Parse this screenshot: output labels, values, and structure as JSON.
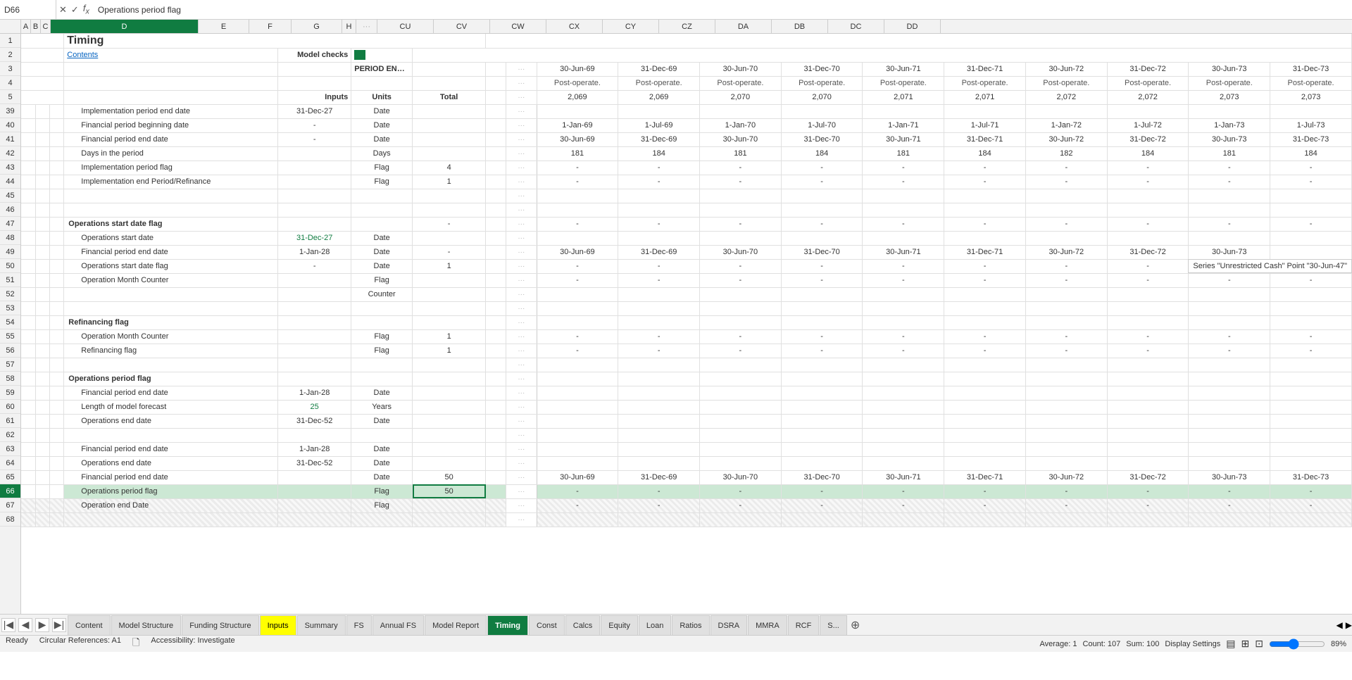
{
  "formulaBar": {
    "cellRef": "D66",
    "formula": "Operations period flag"
  },
  "title": "Timing",
  "contentsLink": "Contents",
  "modelChecks": "Model checks",
  "periodEndDate": "PERIOD END DATE",
  "columnHeaders": [
    "A",
    "B",
    "C",
    "D",
    "E",
    "F",
    "G",
    "H",
    "",
    "CU",
    "CV",
    "CW",
    "CX",
    "CY",
    "CZ",
    "DA",
    "DB",
    "DC",
    "DD"
  ],
  "subHeaders": {
    "inputs": "Inputs",
    "units": "Units",
    "total": "Total"
  },
  "periods": [
    "30-Jun-69",
    "31-Dec-69",
    "30-Jun-70",
    "31-Dec-70",
    "30-Jun-71",
    "31-Dec-71",
    "30-Jun-72",
    "31-Dec-72",
    "30-Jun-73",
    "31-Dec-73"
  ],
  "periodType": "Post-operate.",
  "periodNumbers": [
    "2,069",
    "2,069",
    "2,070",
    "2,070",
    "2,071",
    "2,071",
    "2,072",
    "2,072",
    "2,073",
    "2,073"
  ],
  "rows": [
    {
      "num": 39,
      "label": "Implementation period end date",
      "input": "31-Dec-27",
      "unit": "Date",
      "total": "",
      "values": []
    },
    {
      "num": 40,
      "label": "Financial period beginning date",
      "input": "-",
      "unit": "Date",
      "total": "",
      "values": [
        "1-Jan-69",
        "1-Jul-69",
        "1-Jan-70",
        "1-Jul-70",
        "1-Jan-71",
        "1-Jul-71",
        "1-Jan-72",
        "1-Jul-72",
        "1-Jan-73",
        "1-Jul-73"
      ]
    },
    {
      "num": 41,
      "label": "Financial period end date",
      "input": "-",
      "unit": "Date",
      "total": "",
      "values": [
        "30-Jun-69",
        "31-Dec-69",
        "30-Jun-70",
        "31-Dec-70",
        "30-Jun-71",
        "31-Dec-71",
        "30-Jun-72",
        "31-Dec-72",
        "30-Jun-73",
        "31-Dec-73"
      ]
    },
    {
      "num": 42,
      "label": "Days in the period",
      "input": "",
      "unit": "Days",
      "total": "",
      "values": [
        "181",
        "184",
        "181",
        "184",
        "181",
        "184",
        "182",
        "184",
        "181",
        "184"
      ]
    },
    {
      "num": 43,
      "label": "Implementation period flag",
      "input": "",
      "unit": "Flag",
      "total": "4",
      "values": [
        "-",
        "-",
        "-",
        "-",
        "-",
        "-",
        "-",
        "-",
        "-",
        "-"
      ]
    },
    {
      "num": 44,
      "label": "Implementation end Period/Refinance",
      "input": "",
      "unit": "Flag",
      "total": "1",
      "values": [
        "-",
        "-",
        "-",
        "-",
        "-",
        "-",
        "-",
        "-",
        "-",
        "-"
      ]
    },
    {
      "num": 45,
      "label": "",
      "input": "",
      "unit": "",
      "total": "",
      "values": []
    },
    {
      "num": 46,
      "label": "",
      "input": "",
      "unit": "",
      "total": "",
      "values": []
    },
    {
      "num": 47,
      "label": "Operations start date flag",
      "input": "",
      "unit": "",
      "total": "-",
      "values": [
        "-",
        "-",
        "-",
        "-",
        "-",
        "-",
        "-",
        "-",
        "-",
        "-"
      ],
      "bold": true
    },
    {
      "num": 48,
      "label": "Operations start date",
      "input": "31-Dec-27",
      "unit": "Date",
      "total": "",
      "values": [],
      "inputGreen": true
    },
    {
      "num": 49,
      "label": "Financial period end date",
      "input": "1-Jan-28",
      "unit": "Date",
      "total": "-",
      "values": [
        "30-Jun-69",
        "31-Dec-69",
        "30-Jun-70",
        "31-Dec-70",
        "30-Jun-71",
        "31-Dec-71",
        "30-Jun-72",
        "31-Dec-72",
        "30-Jun-73",
        ""
      ],
      "hasTooltip": true
    },
    {
      "num": 50,
      "label": "Operations start date flag",
      "input": "-",
      "unit": "Date",
      "total": "1",
      "values": [
        "-",
        "-",
        "-",
        "-",
        "-",
        "-",
        "-",
        "-",
        "-",
        "-"
      ]
    },
    {
      "num": 51,
      "label": "Operation Month Counter",
      "input": "",
      "unit": "Flag",
      "total": "",
      "values": [
        "-",
        "-",
        "-",
        "-",
        "-",
        "-",
        "-",
        "-",
        "-",
        "-"
      ]
    },
    {
      "num": 52,
      "label": "",
      "input": "",
      "unit": "Counter",
      "total": "",
      "values": []
    },
    {
      "num": 53,
      "label": "",
      "input": "",
      "unit": "",
      "total": "",
      "values": []
    },
    {
      "num": 54,
      "label": "Refinancing flag",
      "input": "",
      "unit": "",
      "total": "",
      "values": [],
      "bold": true
    },
    {
      "num": 55,
      "label": "Operation Month Counter",
      "input": "",
      "unit": "Flag",
      "total": "1",
      "values": [
        "-",
        "-",
        "-",
        "-",
        "-",
        "-",
        "-",
        "-",
        "-",
        "-"
      ]
    },
    {
      "num": 56,
      "label": "Refinancing flag",
      "input": "",
      "unit": "Flag",
      "total": "1",
      "values": [
        "-",
        "-",
        "-",
        "-",
        "-",
        "-",
        "-",
        "-",
        "-",
        "-"
      ]
    },
    {
      "num": 57,
      "label": "",
      "input": "",
      "unit": "",
      "total": "",
      "values": []
    },
    {
      "num": 58,
      "label": "Operations period flag",
      "input": "",
      "unit": "",
      "total": "",
      "values": [],
      "bold": true
    },
    {
      "num": 59,
      "label": "Financial period end date",
      "input": "1-Jan-28",
      "unit": "Date",
      "total": "",
      "values": []
    },
    {
      "num": 60,
      "label": "Length of model forecast",
      "input": "25",
      "unit": "Years",
      "total": "",
      "values": [],
      "inputGreen": true
    },
    {
      "num": 61,
      "label": "Operations end date",
      "input": "31-Dec-52",
      "unit": "Date",
      "total": "",
      "values": []
    },
    {
      "num": 62,
      "label": "",
      "input": "",
      "unit": "",
      "total": "",
      "values": []
    },
    {
      "num": 63,
      "label": "Financial period end date",
      "input": "1-Jan-28",
      "unit": "Date",
      "total": "",
      "values": []
    },
    {
      "num": 64,
      "label": "Operations end date",
      "input": "31-Dec-52",
      "unit": "Date",
      "total": "",
      "values": []
    },
    {
      "num": 65,
      "label": "Financial period end date",
      "input": "",
      "unit": "Date",
      "total": "50",
      "values": [
        "30-Jun-69",
        "31-Dec-69",
        "30-Jun-70",
        "31-Dec-70",
        "30-Jun-71",
        "31-Dec-71",
        "30-Jun-72",
        "31-Dec-72",
        "30-Jun-73",
        "31-Dec-73"
      ]
    },
    {
      "num": 66,
      "label": "Operations period flag",
      "input": "",
      "unit": "Flag",
      "total": "50",
      "values": [
        "-",
        "-",
        "-",
        "-",
        "-",
        "-",
        "-",
        "-",
        "-",
        "-"
      ],
      "selected": true
    },
    {
      "num": 67,
      "label": "Operation end Date",
      "input": "",
      "unit": "Flag",
      "total": "",
      "values": [
        "-",
        "-",
        "-",
        "-",
        "-",
        "-",
        "-",
        "-",
        "-",
        "-"
      ],
      "hatch": true
    },
    {
      "num": 68,
      "label": "",
      "input": "",
      "unit": "",
      "total": "",
      "values": [],
      "hatch": true
    }
  ],
  "tabs": [
    {
      "label": "Content",
      "style": "normal"
    },
    {
      "label": "Model Structure",
      "style": "normal"
    },
    {
      "label": "Funding Structure",
      "style": "normal"
    },
    {
      "label": "Inputs",
      "style": "yellow"
    },
    {
      "label": "Summary",
      "style": "normal"
    },
    {
      "label": "FS",
      "style": "normal"
    },
    {
      "label": "Annual FS",
      "style": "normal"
    },
    {
      "label": "Model Report",
      "style": "normal"
    },
    {
      "label": "Timing",
      "style": "active-green"
    },
    {
      "label": "Const",
      "style": "normal"
    },
    {
      "label": "Calcs",
      "style": "normal"
    },
    {
      "label": "Equity",
      "style": "normal"
    },
    {
      "label": "Loan",
      "style": "normal"
    },
    {
      "label": "Ratios",
      "style": "normal"
    },
    {
      "label": "DSRA",
      "style": "normal"
    },
    {
      "label": "MMRA",
      "style": "normal"
    },
    {
      "label": "RCF",
      "style": "normal"
    },
    {
      "label": "S...",
      "style": "normal"
    }
  ],
  "statusBar": {
    "ready": "Ready",
    "circularRefs": "Circular References: A1",
    "accessibility": "Accessibility: Investigate",
    "average": "Average: 1",
    "count": "Count: 107",
    "sum": "Sum: 100",
    "displaySettings": "Display Settings",
    "zoom": "89%"
  },
  "tooltip": "Series \"Unrestricted Cash\" Point \"30-Jun-47\""
}
